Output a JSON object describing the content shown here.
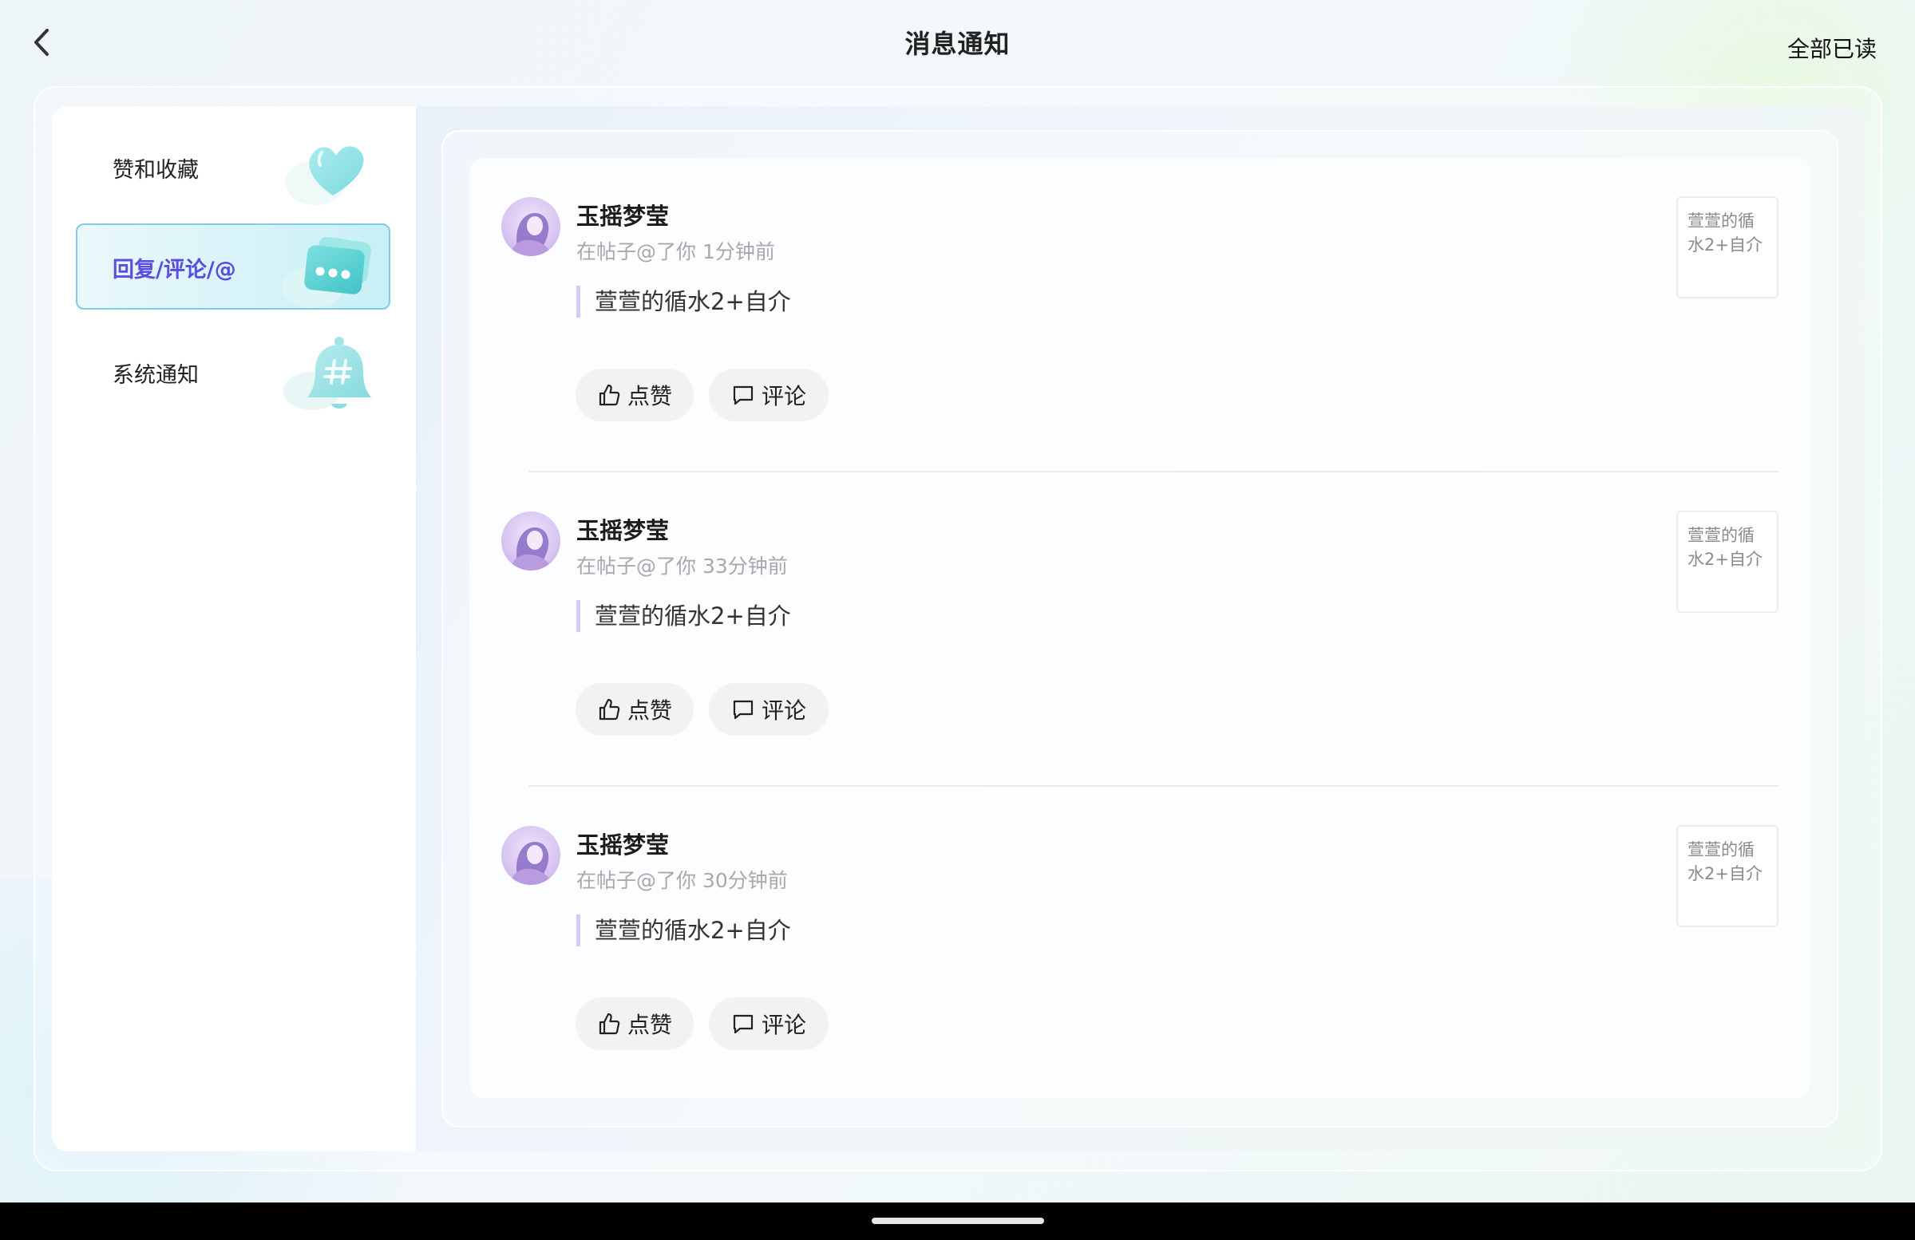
{
  "header": {
    "title": "消息通知",
    "mark_all_read": "全部已读",
    "back_icon": "chevron-left-icon"
  },
  "sidebar": {
    "items": [
      {
        "label": "赞和收藏",
        "icon": "heart-icon",
        "active": false
      },
      {
        "label": "回复/评论/@",
        "icon": "chat-bubbles-icon",
        "active": true
      },
      {
        "label": "系统通知",
        "icon": "bell-hash-icon",
        "active": false
      }
    ],
    "accent_color": "#5a4de0"
  },
  "notifications": [
    {
      "username": "玉摇梦莹",
      "meta": "在帖子@了你 1分钟前",
      "quote": "萱萱的循水2+自介",
      "like_label": "点赞",
      "comment_label": "评论",
      "thumb_text": "萱萱的循水2+自介"
    },
    {
      "username": "玉摇梦莹",
      "meta": "在帖子@了你 33分钟前",
      "quote": "萱萱的循水2+自介",
      "like_label": "点赞",
      "comment_label": "评论",
      "thumb_text": "萱萱的循水2+自介"
    },
    {
      "username": "玉摇梦莹",
      "meta": "在帖子@了你 30分钟前",
      "quote": "萱萱的循水2+自介",
      "like_label": "点赞",
      "comment_label": "评论",
      "thumb_text": "萱萱的循水2+自介"
    }
  ]
}
